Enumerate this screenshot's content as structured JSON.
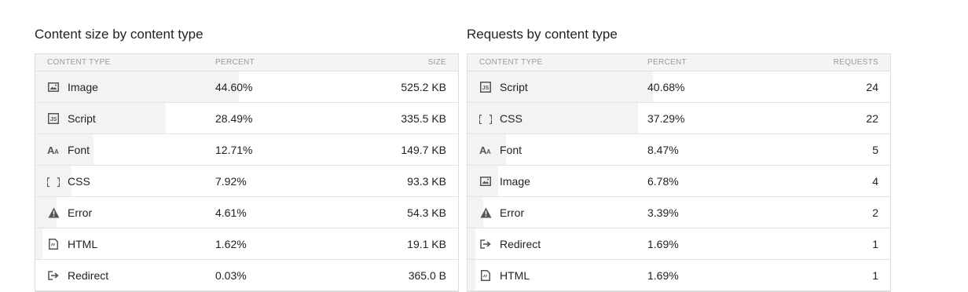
{
  "left": {
    "title": "Content size by content type",
    "headers": {
      "type": "CONTENT TYPE",
      "percent": "PERCENT",
      "value": "SIZE"
    },
    "rows": [
      {
        "icon": "image-icon",
        "label": "Image",
        "percent": "44.60%",
        "value": "525.2 KB",
        "fraction": 0.446
      },
      {
        "icon": "script-icon",
        "label": "Script",
        "percent": "28.49%",
        "value": "335.5 KB",
        "fraction": 0.2849
      },
      {
        "icon": "font-icon",
        "label": "Font",
        "percent": "12.71%",
        "value": "149.7 KB",
        "fraction": 0.1271
      },
      {
        "icon": "css-icon",
        "label": "CSS",
        "percent": "7.92%",
        "value": "93.3 KB",
        "fraction": 0.0792
      },
      {
        "icon": "error-icon",
        "label": "Error",
        "percent": "4.61%",
        "value": "54.3 KB",
        "fraction": 0.0461
      },
      {
        "icon": "html-icon",
        "label": "HTML",
        "percent": "1.62%",
        "value": "19.1 KB",
        "fraction": 0.0162
      },
      {
        "icon": "redirect-icon",
        "label": "Redirect",
        "percent": "0.03%",
        "value": "365.0 B",
        "fraction": 0.0003
      }
    ]
  },
  "right": {
    "title": "Requests by content type",
    "headers": {
      "type": "CONTENT TYPE",
      "percent": "PERCENT",
      "value": "REQUESTS"
    },
    "rows": [
      {
        "icon": "script-icon",
        "label": "Script",
        "percent": "40.68%",
        "value": "24",
        "fraction": 0.4068
      },
      {
        "icon": "css-icon",
        "label": "CSS",
        "percent": "37.29%",
        "value": "22",
        "fraction": 0.3729
      },
      {
        "icon": "font-icon",
        "label": "Font",
        "percent": "8.47%",
        "value": "5",
        "fraction": 0.0847
      },
      {
        "icon": "image-icon",
        "label": "Image",
        "percent": "6.78%",
        "value": "4",
        "fraction": 0.0678
      },
      {
        "icon": "error-icon",
        "label": "Error",
        "percent": "3.39%",
        "value": "2",
        "fraction": 0.0339
      },
      {
        "icon": "redirect-icon",
        "label": "Redirect",
        "percent": "1.69%",
        "value": "1",
        "fraction": 0.0169
      },
      {
        "icon": "html-icon",
        "label": "HTML",
        "percent": "1.69%",
        "value": "1",
        "fraction": 0.0169
      }
    ]
  }
}
